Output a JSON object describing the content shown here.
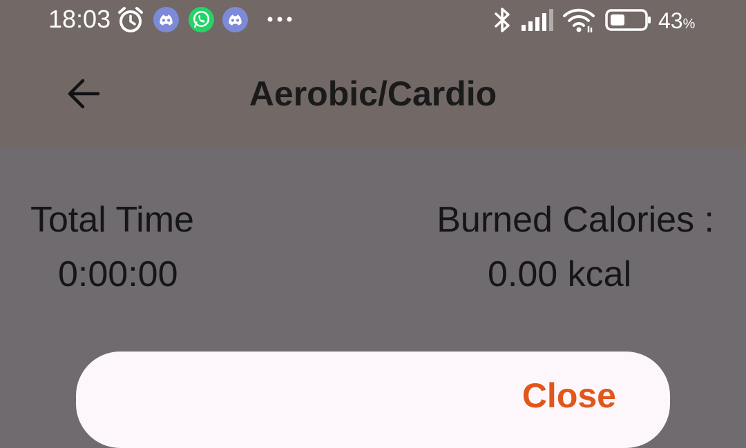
{
  "status_bar": {
    "time": "18:03",
    "battery": "43",
    "battery_unit": "%",
    "notification_icons": [
      "alarm-icon",
      "discord-icon",
      "whatsapp-icon",
      "discord-icon",
      "more-icon"
    ],
    "system_icons": [
      "bluetooth-icon",
      "signal-icon",
      "wifi-icon",
      "battery-icon"
    ]
  },
  "app_bar": {
    "title": "Aerobic/Cardio",
    "back_icon": "back-arrow-icon"
  },
  "stats": {
    "total_time_label": "Total Time",
    "total_time_value": "0:00:00",
    "calories_label": "Burned Calories :",
    "calories_value": "0.00 kcal"
  },
  "sheet": {
    "close_label": "Close"
  },
  "colors": {
    "header_bg": "#726866",
    "content_bg": "#6f6b6f",
    "sheet_bg": "#fdf7fb",
    "accent": "#e0571b",
    "whatsapp": "#25d366",
    "discord": "#7c8ad8"
  }
}
